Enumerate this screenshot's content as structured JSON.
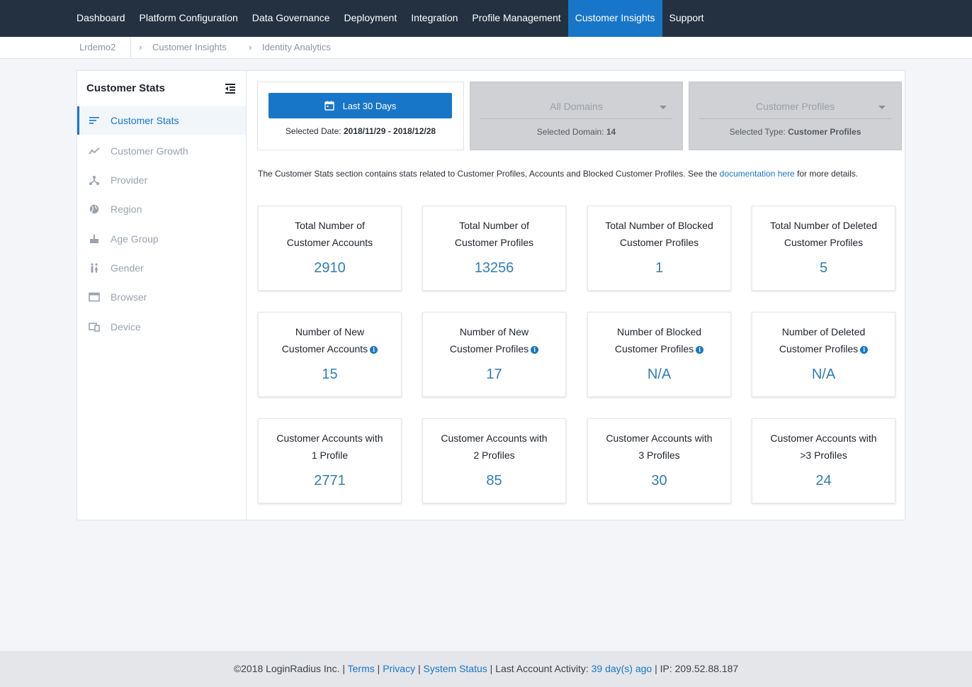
{
  "nav": {
    "items": [
      "Dashboard",
      "Platform Configuration",
      "Data Governance",
      "Deployment",
      "Integration",
      "Profile Management",
      "Customer Insights",
      "Support"
    ],
    "active": "Customer Insights"
  },
  "breadcrumb": {
    "app": "Lrdemo2",
    "items": [
      "Customer Insights",
      "Identity Analytics"
    ]
  },
  "sidebar": {
    "title": "Customer Stats",
    "items": [
      {
        "label": "Customer Stats",
        "icon": "stats-lines-icon",
        "active": true
      },
      {
        "label": "Customer Growth",
        "icon": "trend-line-icon",
        "active": false
      },
      {
        "label": "Provider",
        "icon": "provider-network-icon",
        "active": false
      },
      {
        "label": "Region",
        "icon": "globe-icon",
        "active": false
      },
      {
        "label": "Age Group",
        "icon": "cake-icon",
        "active": false
      },
      {
        "label": "Gender",
        "icon": "gender-people-icon",
        "active": false
      },
      {
        "label": "Browser",
        "icon": "browser-window-icon",
        "active": false
      },
      {
        "label": "Device",
        "icon": "devices-icon",
        "active": false
      }
    ]
  },
  "filters": {
    "date_button": "Last 30 Days",
    "date_label": "Selected Date: ",
    "date_value": "2018/11/29 - 2018/12/28",
    "domain_select": "All Domains",
    "domain_label": "Selected Domain: ",
    "domain_value": "14",
    "type_select": "Customer Profiles",
    "type_label": "Selected Type: ",
    "type_value": "Customer Profiles"
  },
  "description": {
    "text_before": "The Customer Stats section contains stats related to Customer Profiles, Accounts and Blocked Customer Profiles. See the ",
    "link": "documentation here",
    "text_after": " for more details."
  },
  "cards": [
    {
      "line1": "Total Number of",
      "line2": "Customer Accounts",
      "value": "2910",
      "info": false
    },
    {
      "line1": "Total Number of",
      "line2": "Customer Profiles",
      "value": "13256",
      "info": false
    },
    {
      "line1": "Total Number of Blocked",
      "line2": "Customer Profiles",
      "value": "1",
      "info": false
    },
    {
      "line1": "Total Number of Deleted",
      "line2": "Customer Profiles",
      "value": "5",
      "info": false
    },
    {
      "line1": "Number of New",
      "line2": "Customer Accounts",
      "value": "15",
      "info": true
    },
    {
      "line1": "Number of New",
      "line2": "Customer Profiles",
      "value": "17",
      "info": true
    },
    {
      "line1": "Number of Blocked",
      "line2": "Customer Profiles",
      "value": "N/A",
      "info": true
    },
    {
      "line1": "Number of Deleted",
      "line2": "Customer Profiles",
      "value": "N/A",
      "info": true
    },
    {
      "line1": "Customer Accounts with",
      "line2": "1 Profile",
      "value": "2771",
      "info": false
    },
    {
      "line1": "Customer Accounts with",
      "line2": "2 Profiles",
      "value": "85",
      "info": false
    },
    {
      "line1": "Customer Accounts with",
      "line2": "3 Profiles",
      "value": "30",
      "info": false
    },
    {
      "line1": "Customer Accounts with",
      "line2": ">3 Profiles",
      "value": "24",
      "info": false
    }
  ],
  "footer": {
    "copyright": "©2018 LoginRadius Inc. | ",
    "terms": "Terms",
    "sep1": " | ",
    "privacy": "Privacy",
    "sep2": " | ",
    "status": "System Status",
    "activity_label": " | Last Account Activity: ",
    "activity_value": "39 day(s) ago",
    "ip": " | IP: 209.52.88.187"
  },
  "colors": {
    "nav_bg": "#233141",
    "accent": "#1876c8",
    "value_blue": "#2f7eb9"
  }
}
